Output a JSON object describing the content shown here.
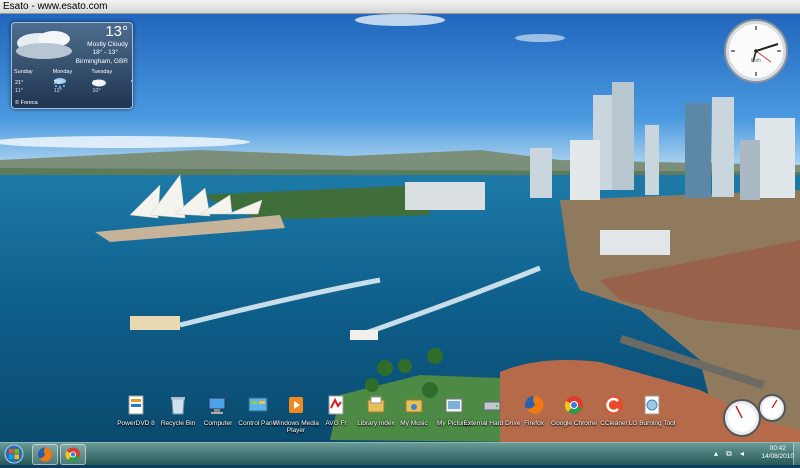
{
  "window": {
    "title": "Esato - www.esato.com"
  },
  "weather": {
    "temperature": "13°",
    "condition": "Mostly Cloudy",
    "range": "18° - 13°",
    "location": "Birmingham, GBR",
    "forecast": [
      {
        "day": "Sunday",
        "high": "21°",
        "low": "11°",
        "icon": "rain-icon"
      },
      {
        "day": "Monday",
        "high": "21°",
        "low": "12°",
        "icon": "cloud-icon"
      },
      {
        "day": "Tuesday",
        "high": "18°",
        "low": "10°",
        "icon": "rain-icon"
      }
    ],
    "credit": "© Foreca"
  },
  "clock": {
    "label": "Bath"
  },
  "desktop_icons": [
    {
      "label": "PowerDVD 8",
      "icon": "powerdvd-icon"
    },
    {
      "label": "Recycle Bin",
      "icon": "recycle-bin-icon"
    },
    {
      "label": "Computer",
      "icon": "computer-icon"
    },
    {
      "label": "Control Panel",
      "icon": "control-panel-icon"
    },
    {
      "label": "Windows Media Player",
      "icon": "media-player-icon"
    },
    {
      "label": "AVG Fr",
      "icon": "avg-icon"
    },
    {
      "label": "Library Index",
      "icon": "library-icon"
    },
    {
      "label": "My Music",
      "icon": "music-folder-icon"
    },
    {
      "label": "My Pictures",
      "icon": "pictures-folder-icon"
    },
    {
      "label": "External Hard Drive",
      "icon": "hard-drive-icon"
    },
    {
      "label": "Firefox",
      "icon": "firefox-icon"
    },
    {
      "label": "Google Chrome",
      "icon": "chrome-icon"
    },
    {
      "label": "CCleaner",
      "icon": "ccleaner-icon"
    },
    {
      "label": "LG Burning Tool",
      "icon": "lg-burning-icon"
    }
  ],
  "taskbar": {
    "clock_time": "00:42",
    "clock_date": "14/08/2010",
    "pinned": [
      "firefox-icon",
      "chrome-icon"
    ]
  },
  "colors": {
    "taskbar": "#4f8a84",
    "sky": "#1f6fc2",
    "water": "#0f5f8a"
  }
}
